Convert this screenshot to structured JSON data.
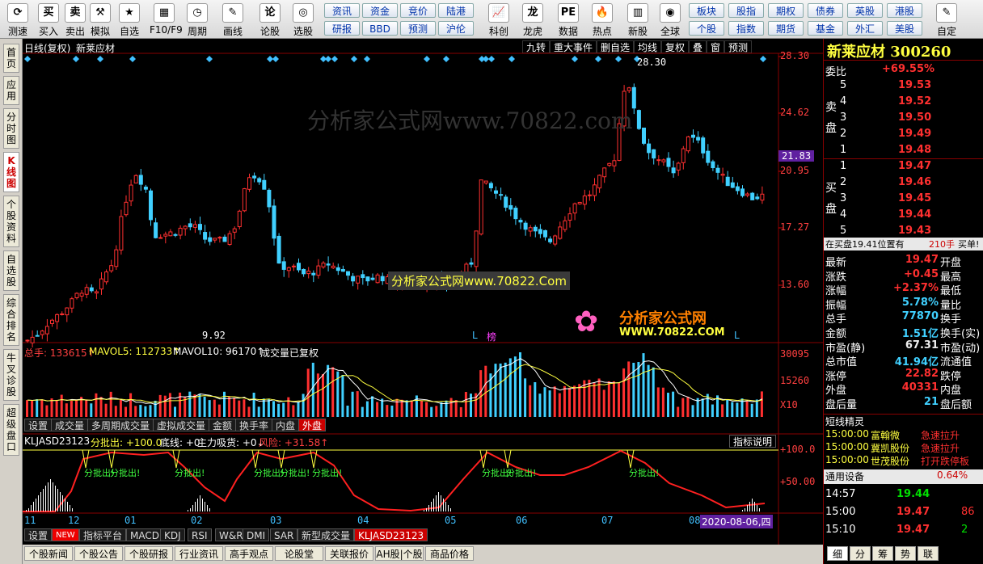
{
  "toolbar": {
    "left_buttons": [
      {
        "name": "refresh",
        "icon": "refresh-icon",
        "glyph": "⟳",
        "label": "测速"
      },
      {
        "name": "buy",
        "icon": "buy-icon",
        "glyph": "买",
        "label": "买入"
      },
      {
        "name": "sell",
        "icon": "sell-icon",
        "glyph": "卖",
        "label": "卖出"
      },
      {
        "name": "simulate",
        "icon": "hammer-icon",
        "glyph": "⚒",
        "label": "模拟"
      },
      {
        "name": "watchlist",
        "icon": "star-icon",
        "glyph": "★",
        "label": "自选"
      },
      {
        "name": "f10",
        "icon": "f10-icon",
        "glyph": "▦",
        "label": "F10/F9"
      },
      {
        "name": "period",
        "icon": "clock-icon",
        "glyph": "◷",
        "label": "周期"
      },
      {
        "name": "draw",
        "icon": "pencil-icon",
        "glyph": "✎",
        "label": "画线"
      },
      {
        "name": "discuss",
        "icon": "discuss-icon",
        "glyph": "论",
        "label": "论股"
      },
      {
        "name": "pick",
        "icon": "pick-icon",
        "glyph": "◎",
        "label": "选股"
      }
    ],
    "small_buttons_top": [
      "资讯",
      "资金",
      "竞价",
      "陆港"
    ],
    "small_buttons_bottom": [
      "研报",
      "BBD",
      "预测",
      "沪伦"
    ],
    "mid_buttons": [
      {
        "name": "tech",
        "icon": "chart-icon",
        "glyph": "📈",
        "label": "科创"
      },
      {
        "name": "dragon",
        "icon": "dragon-icon",
        "glyph": "龙",
        "label": "龙虎"
      },
      {
        "name": "data",
        "icon": "pe-icon",
        "glyph": "PE",
        "label": "数据"
      },
      {
        "name": "hot",
        "icon": "fire-icon",
        "glyph": "🔥",
        "label": "热点"
      },
      {
        "name": "newstock",
        "icon": "newstock-icon",
        "glyph": "▥",
        "label": "新股"
      },
      {
        "name": "global",
        "icon": "globe-icon",
        "glyph": "◉",
        "label": "全球"
      }
    ],
    "right_small_top": [
      "板块",
      "股指",
      "期权",
      "债券",
      "英股",
      "港股"
    ],
    "right_small_bottom": [
      "个股",
      "指数",
      "期货",
      "基金",
      "外汇",
      "美股"
    ],
    "custom": {
      "icon": "custom-icon",
      "glyph": "✎",
      "label": "自定"
    }
  },
  "left_tabs": [
    "首页",
    "应用",
    "分时图",
    "K线图",
    "个股资料",
    "自选股",
    "综合排名",
    "牛叉诊股",
    "超级盘口"
  ],
  "chart": {
    "header_left": "日线(复权)",
    "stock_name": "新莱应材",
    "header_tools": [
      "九转",
      "重大事件",
      "删自选",
      "均线",
      "复权",
      "叠",
      "窗",
      "预测"
    ],
    "watermark_top": "分析家公式网www.70822.com",
    "watermark_mid": "分析家公式网www.70822.Com",
    "logo_text": "分析家公式网",
    "logo_url": "WWW.70822.COM",
    "price_axis": [
      "28.30",
      "24.62",
      "20.95",
      "17.27",
      "13.60"
    ],
    "current_price_tag": "21.83",
    "high_label": "28.30",
    "low_label": "9.92",
    "markers": [
      "L",
      "榜",
      "L"
    ],
    "vol_header": {
      "total": "总手: 133615↑",
      "ma5": "MAVOL5: 112733↑",
      "ma10": "MAVOL10: 96170↑",
      "note": "成交量已复权"
    },
    "vol_axis": [
      "30095",
      "15260",
      "X10"
    ],
    "vol_tabs": [
      "设置",
      "成交量",
      "多周期成交量",
      "虚拟成交量",
      "金额",
      "换手率",
      "内盘",
      "外盘"
    ],
    "ind_header": {
      "name": "KLJASD23123",
      "a": "分批出: +100.0",
      "b": "底线: +0",
      "c": "主力吸货: +0↓",
      "d": "风险: +31.58↑"
    },
    "ind_help": "指标说明",
    "ind_axis": [
      "+100.0",
      "+50.00"
    ],
    "signal_text": "分批出!",
    "months": [
      "11",
      "12",
      "01",
      "02",
      "03",
      "04",
      "05",
      "06",
      "07",
      "08"
    ],
    "date_tag": "2020-08-06,四",
    "ind_tabs": [
      "设置",
      "NEW",
      "指标平台",
      "MACD",
      "KDJ",
      "RSI",
      "W&R",
      "DMI",
      "SAR",
      "新型成交量",
      "KLJASD23123"
    ],
    "bottom_tabs": [
      "个股新闻",
      "个股公告",
      "个股研报",
      "行业资讯",
      "高手观点",
      "论股堂",
      "关联报价",
      "AH股|个股",
      "商品价格"
    ]
  },
  "panel": {
    "title": "新莱应材 300260",
    "ratio_label": "委比",
    "ratio_value": "+69.55%",
    "sell_label": "卖盘",
    "sells": [
      [
        "5",
        "19.53"
      ],
      [
        "4",
        "19.52"
      ],
      [
        "3",
        "19.50"
      ],
      [
        "2",
        "19.49"
      ],
      [
        "1",
        "19.48"
      ]
    ],
    "buy_label": "买盘",
    "buys": [
      [
        "1",
        "19.47"
      ],
      [
        "2",
        "19.46"
      ],
      [
        "3",
        "19.45"
      ],
      [
        "4",
        "19.44"
      ],
      [
        "5",
        "19.43"
      ]
    ],
    "inbuy_text": "在买盘19.41位置有",
    "inbuy_vol": "210手",
    "inbuy_tag": "买单!",
    "stats": [
      {
        "l": "最新",
        "v": "19.47",
        "c": "red",
        "r": "开盘"
      },
      {
        "l": "涨跌",
        "v": "+0.45",
        "c": "red",
        "r": "最高"
      },
      {
        "l": "涨幅",
        "v": "+2.37%",
        "c": "red",
        "r": "最低"
      },
      {
        "l": "振幅",
        "v": "5.78%",
        "c": "cyan",
        "r": "量比"
      },
      {
        "l": "总手",
        "v": "77870",
        "c": "cyan",
        "r": "换手"
      },
      {
        "l": "金额",
        "v": "1.51亿",
        "c": "cyan",
        "r": "换手(实)"
      },
      {
        "l": "市盈(静)",
        "v": "67.31",
        "c": "white",
        "r": "市盈(动)"
      },
      {
        "l": "总市值",
        "v": "41.94亿",
        "c": "cyan",
        "r": "流通值"
      },
      {
        "l": "涨停",
        "v": "22.82",
        "c": "red",
        "r": "跌停"
      },
      {
        "l": "外盘",
        "v": "40331",
        "c": "red",
        "r": "内盘"
      },
      {
        "l": "盘后量",
        "v": "21",
        "c": "cyan",
        "r": "盘后额"
      }
    ],
    "short_title": "短线精灵",
    "short_rows": [
      [
        "15:00:00",
        "富翰微",
        "急速拉升"
      ],
      [
        "15:00:00",
        "冀凯股份",
        "急速拉升"
      ],
      [
        "15:00:00",
        "世茂股份",
        "打开跌停板"
      ]
    ],
    "sector_name": "通用设备",
    "sector_pct": "0.64%",
    "ticks": [
      [
        "14:57",
        "19.44",
        ""
      ],
      [
        "15:00",
        "19.47",
        "86"
      ],
      [
        "15:10",
        "19.47",
        "2"
      ]
    ],
    "bottom_tabs": [
      "细",
      "分",
      "筹",
      "势",
      "联"
    ]
  }
}
